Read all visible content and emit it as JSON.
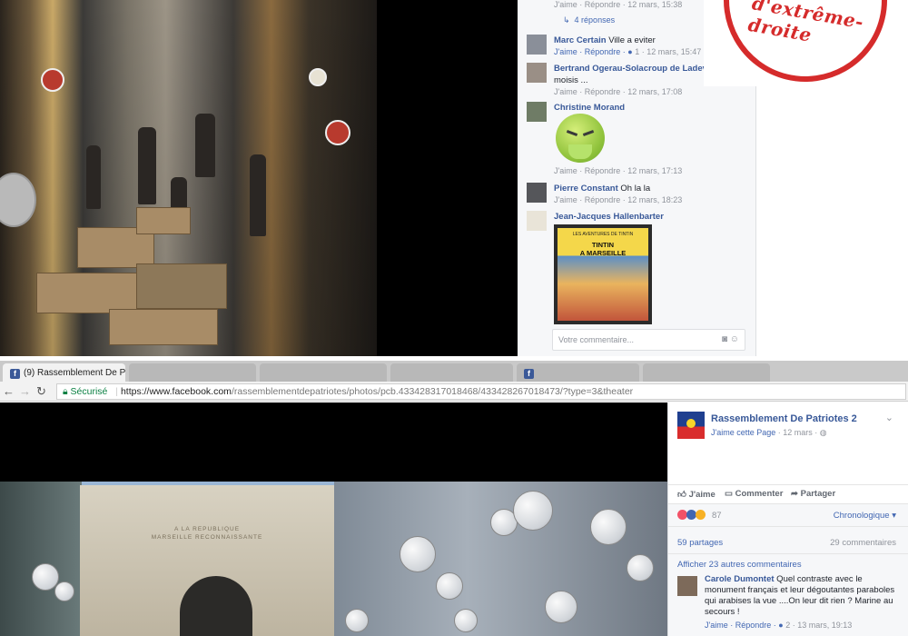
{
  "top_comments": {
    "reply_to_first": {
      "meta": "J'aime · Répondre · 12 mars, 15:38",
      "replies": "4 réponses"
    },
    "items": [
      {
        "name": "Marc Certain",
        "text": "Ville a eviter",
        "meta": "J'aime · Répondre · ",
        "likes": "1",
        "time": " · 12 mars, 15:47"
      },
      {
        "name": "Bertrand Ogerau-Solacroup de Ladevie",
        "text": "moisis ...",
        "meta": "J'aime · Répondre · 12 mars, 17:08"
      },
      {
        "name": "Christine Morand",
        "text": "",
        "meta": "J'aime · Répondre · 12 mars, 17:13"
      },
      {
        "name": "Pierre Constant",
        "text": "Oh la la",
        "meta": "J'aime · Répondre · 12 mars, 18:23"
      },
      {
        "name": "Jean-Jacques Hallenbarter",
        "text": ""
      }
    ],
    "tintin": {
      "small": "LES AVENTURES DE TINTIN",
      "title": "TINTIN\nA MARSEILLE"
    },
    "input_placeholder": "Votre commentaire..."
  },
  "stamp": {
    "text": "d'extrême-droite"
  },
  "browser": {
    "tabs": [
      {
        "label": "(9) Rassemblement De P",
        "active": true
      },
      {
        "label": "",
        "active": false
      },
      {
        "label": "",
        "active": false
      },
      {
        "label": "",
        "active": false
      },
      {
        "label": "",
        "active": false
      },
      {
        "label": "",
        "active": false
      }
    ],
    "close": "✕",
    "secure_label": "Sécurisé",
    "url_host": "https://www.facebook.com",
    "url_path": "/rassemblementdepatriotes/photos/pcb.433428317018468/433428267018473/?type=3&theater"
  },
  "photo_bottom": {
    "inscription": "A LA REPUBLIQUE\nMARSEILLE RECONNAISSANTE"
  },
  "post": {
    "page_name": "Rassemblement De Patriotes 2",
    "like_page": "J'aime cette Page",
    "date": " · 12 mars · ",
    "actions": {
      "like": "J'aime",
      "comment": "Commenter",
      "share": "Partager"
    },
    "reaction_count": "87",
    "sort": "Chronologique ▾",
    "shares": "59 partages",
    "comments": "29 commentaires",
    "more_comments": "Afficher 23 autres commentaires",
    "carole": {
      "name": "Carole Dumontet",
      "text": " Quel contraste avec le monument français et leur dégoutantes paraboles qui arabises la vue ....On leur dit rien ? Marine au secours !",
      "meta": "J'aime · Répondre · ",
      "likes": "2",
      "time": " · 13 mars, 19:13"
    }
  },
  "colors": {
    "facebook_blue": "#4267b2",
    "stamp_red": "#d52b2b",
    "secure_green": "#0b8043"
  }
}
